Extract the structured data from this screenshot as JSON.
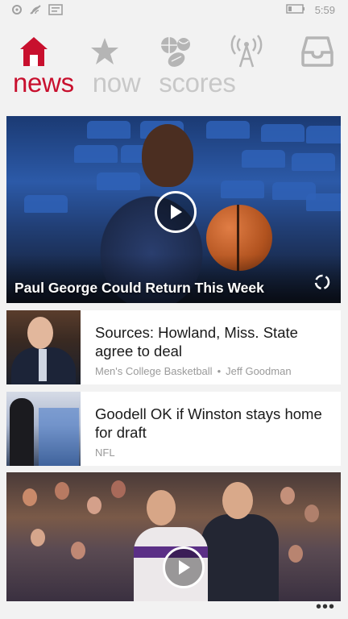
{
  "status_bar": {
    "time": "5:59",
    "icons": [
      "sync-icon",
      "wifi-icon",
      "message-icon",
      "battery-icon"
    ]
  },
  "nav": {
    "icons": [
      {
        "name": "home-icon",
        "color": "#c8102e"
      },
      {
        "name": "star-icon",
        "color": "#b5b5b5"
      },
      {
        "name": "sports-balls-icon",
        "color": "#b5b5b5"
      },
      {
        "name": "broadcast-tower-icon",
        "color": "#b5b5b5"
      },
      {
        "name": "inbox-icon",
        "color": "#b5b5b5"
      }
    ],
    "pivots": [
      "news",
      "now",
      "scores"
    ],
    "active_color": "#c8102e"
  },
  "hero": {
    "caption": "Paul George Could Return This Week"
  },
  "stories": [
    {
      "headline": "Sources: Howland, Miss. State agree to deal",
      "category": "Men's College Basketball",
      "author": "Jeff Goodman"
    },
    {
      "headline": "Goodell OK if Winston stays home for draft",
      "category": "NFL"
    }
  ],
  "app_bar": {
    "more_label": "•••"
  }
}
